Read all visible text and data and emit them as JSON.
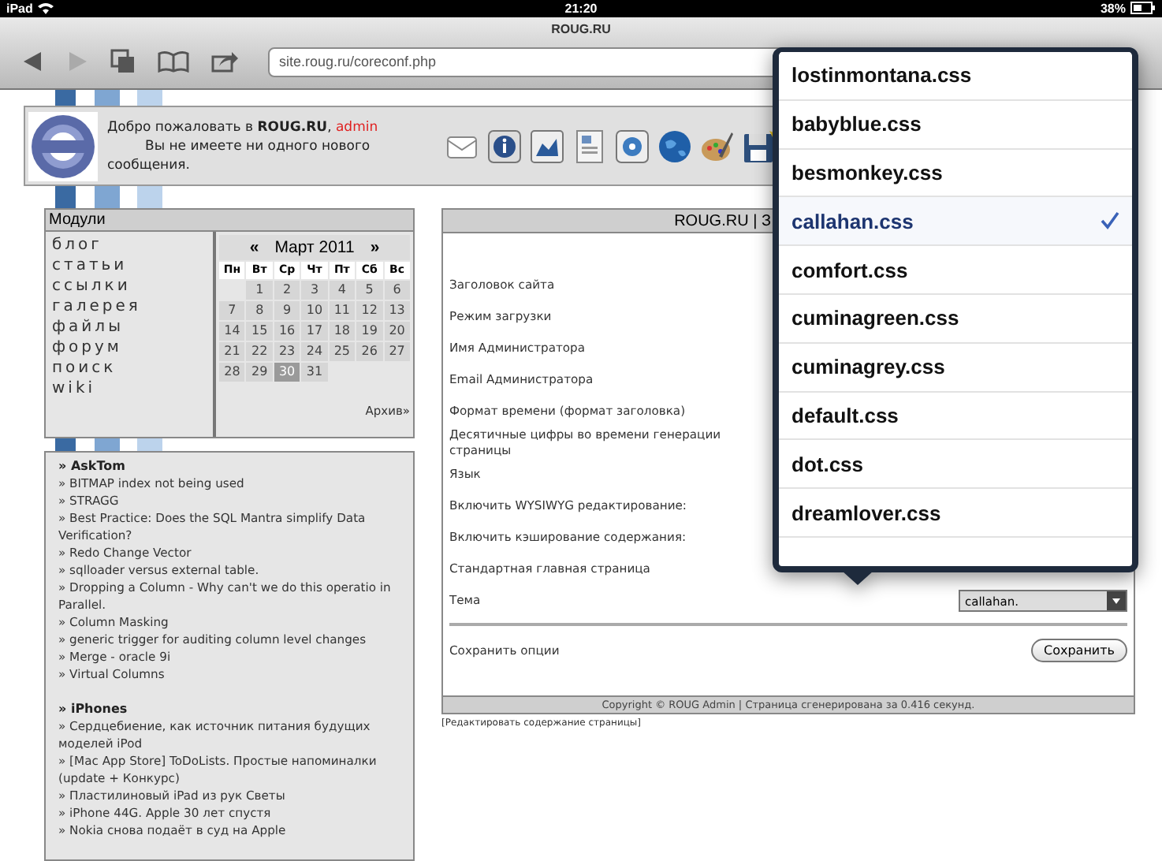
{
  "status_bar": {
    "device": "iPad",
    "time": "21:20",
    "battery": "38%"
  },
  "browser": {
    "title": "ROUG.RU",
    "url": "site.roug.ru/coreconf.php",
    "back_enabled": true,
    "forward_enabled": false
  },
  "site_header": {
    "welcome": "Добро пожаловать в **ROUG.RU**, ",
    "user": "admin",
    "message": "Вы не имеете ни одного нового сообщения."
  },
  "modules": {
    "title": "Модули",
    "items": [
      "блог",
      "статьи",
      "ссылки",
      "галерея",
      "файлы",
      "форум",
      "поиск",
      "wiki"
    ]
  },
  "calendar": {
    "prev": "«",
    "month": "Март 2011",
    "next": "»",
    "weekdays": [
      "Пн",
      "Вт",
      "Ср",
      "Чт",
      "Пт",
      "Сб",
      "Вс"
    ],
    "days": [
      {
        "kind": "blank"
      },
      {
        "kind": "day",
        "day": "1",
        "selected": false
      },
      {
        "kind": "day",
        "day": "2",
        "selected": false
      },
      {
        "kind": "day",
        "day": "3",
        "selected": false
      },
      {
        "kind": "day",
        "day": "4",
        "selected": false
      },
      {
        "kind": "day",
        "day": "5",
        "selected": false
      },
      {
        "kind": "day",
        "day": "6",
        "selected": false
      },
      {
        "kind": "day",
        "day": "7",
        "selected": false
      },
      {
        "kind": "day",
        "day": "8",
        "selected": false
      },
      {
        "kind": "day",
        "day": "9",
        "selected": false
      },
      {
        "kind": "day",
        "day": "10",
        "selected": false
      },
      {
        "kind": "day",
        "day": "11",
        "selected": false
      },
      {
        "kind": "day",
        "day": "12",
        "selected": false
      },
      {
        "kind": "day",
        "day": "13",
        "selected": false
      },
      {
        "kind": "day",
        "day": "14",
        "selected": false
      },
      {
        "kind": "day",
        "day": "15",
        "selected": false
      },
      {
        "kind": "day",
        "day": "16",
        "selected": false
      },
      {
        "kind": "day",
        "day": "17",
        "selected": false
      },
      {
        "kind": "day",
        "day": "18",
        "selected": false
      },
      {
        "kind": "day",
        "day": "19",
        "selected": false
      },
      {
        "kind": "day",
        "day": "20",
        "selected": false
      },
      {
        "kind": "day",
        "day": "21",
        "selected": false
      },
      {
        "kind": "day",
        "day": "22",
        "selected": false
      },
      {
        "kind": "day",
        "day": "23",
        "selected": false
      },
      {
        "kind": "day",
        "day": "24",
        "selected": false
      },
      {
        "kind": "day",
        "day": "25",
        "selected": false
      },
      {
        "kind": "day",
        "day": "26",
        "selected": false
      },
      {
        "kind": "day",
        "day": "27",
        "selected": false
      },
      {
        "kind": "day",
        "day": "28",
        "selected": false
      },
      {
        "kind": "day",
        "day": "29",
        "selected": false
      },
      {
        "kind": "day",
        "day": "30",
        "selected": true
      },
      {
        "kind": "day",
        "day": "31",
        "selected": false
      }
    ],
    "archive": "Архив»"
  },
  "news": [
    {
      "title": "» AskTom",
      "items": [
        "» BITMAP index not being used",
        "» STRAGG",
        "» Best Practice: Does the SQL Mantra simplify Data Verification?",
        "» Redo Change Vector",
        "» sqlloader versus external table.",
        "» Dropping a Column - Why can't we do this operatio in Parallel.",
        "» Column Masking",
        "» generic trigger for auditing column level changes",
        "» Merge - oracle 9i",
        "» Virtual Columns"
      ]
    },
    {
      "title": "» iPhones",
      "items": [
        "» Сердцебиение, как источник питания будущих моделей iPod",
        "» [Mac App Store] ToDoLists. Простые напоминалки (update + Конкурс)",
        "» Пластилиновый iPad из рук Светы",
        "» iPhone 44G. Apple 30 лет спустя",
        "» Nokia снова подаёт в суд на Apple"
      ]
    }
  ],
  "settings": {
    "title": "ROUG.RU | З",
    "rows": [
      {
        "kind": "text",
        "label": "Заголовок сайта"
      },
      {
        "kind": "text",
        "label": "Режим загрузки"
      },
      {
        "kind": "text",
        "label": "Имя Администратора"
      },
      {
        "kind": "text",
        "label": "Email Администратора"
      },
      {
        "kind": "text",
        "label": "Формат времени (формат заголовка)"
      },
      {
        "kind": "text",
        "label": "Десятичные цифры во времени генерации страницы"
      },
      {
        "kind": "text",
        "label": "Язык"
      },
      {
        "kind": "text",
        "label": "Включить WYSIWYG редактирование:"
      },
      {
        "kind": "text",
        "label": "Включить кэширование содержания:"
      },
      {
        "kind": "text",
        "label": "Стандартная главная страница"
      },
      {
        "kind": "select",
        "label": "Тема",
        "value": "callahan."
      }
    ],
    "save_label": "Сохранить опции",
    "save_button": "Сохранить",
    "footer": "Copyright © ROUG Admin | Страница сгенерирована за 0.416 секунд.",
    "edit_link": "[Редактировать содержание страницы]"
  },
  "theme_picker": {
    "options": [
      {
        "label": "lostinmontana.css",
        "selected": false
      },
      {
        "label": "babyblue.css",
        "selected": false
      },
      {
        "label": "besmonkey.css",
        "selected": false
      },
      {
        "label": "callahan.css",
        "selected": true
      },
      {
        "label": "comfort.css",
        "selected": false
      },
      {
        "label": "cuminagreen.css",
        "selected": false
      },
      {
        "label": "cuminagrey.css",
        "selected": false
      },
      {
        "label": "default.css",
        "selected": false
      },
      {
        "label": "dot.css",
        "selected": false
      },
      {
        "label": "dreamlover.css",
        "selected": false
      }
    ]
  }
}
